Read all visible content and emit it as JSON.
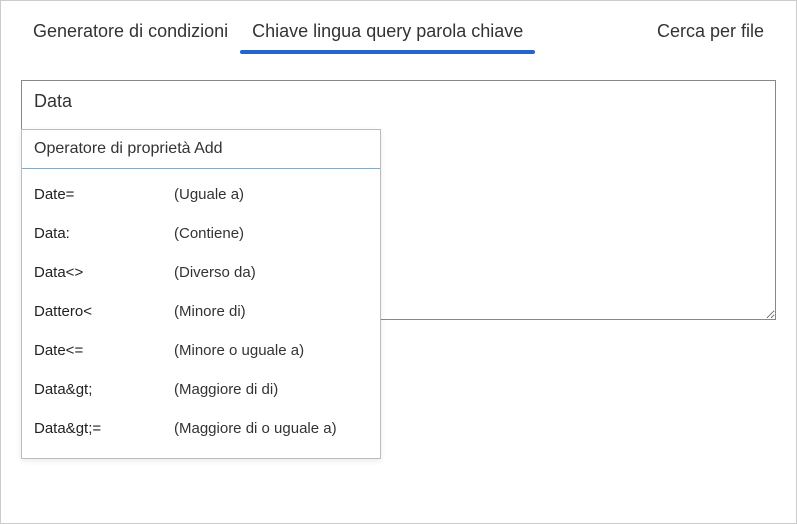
{
  "tabs": {
    "items": [
      {
        "label": "Generatore di condizioni",
        "active": false
      },
      {
        "label": "Chiave lingua query parola chiave",
        "active": true
      },
      {
        "label": "Cerca per file",
        "active": false
      }
    ]
  },
  "query": {
    "value": "Data"
  },
  "dropdown": {
    "header": "Operatore di proprietà Add",
    "items": [
      {
        "name": "Date=",
        "desc": "(Uguale a)"
      },
      {
        "name": "Data:",
        "desc": "(Contiene)"
      },
      {
        "name": "Data<>",
        "desc": "(Diverso da)"
      },
      {
        "name": "Dattero<",
        "desc": "(Minore di)"
      },
      {
        "name": "Date<=",
        "desc": "(Minore o    uguale a)"
      },
      {
        "name": "Data&gt;",
        "desc": "(Maggiore di  di)"
      },
      {
        "name": "Data&gt;=",
        "desc": "(Maggiore di  o uguale a)"
      }
    ]
  }
}
